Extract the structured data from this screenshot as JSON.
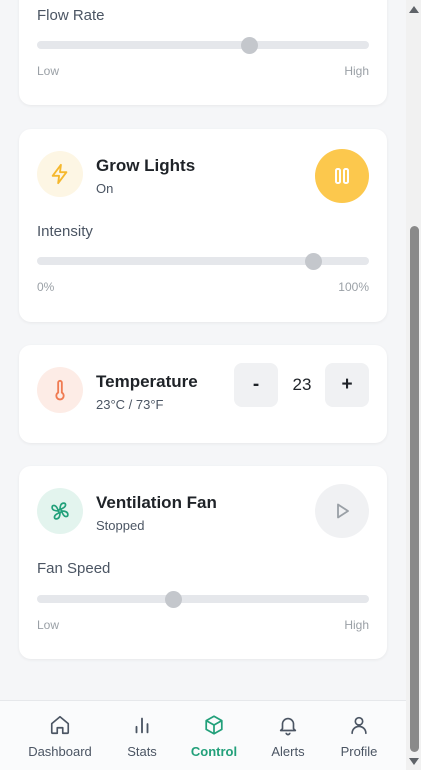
{
  "cards": {
    "flow": {
      "slider_label": "Flow Rate",
      "min_label": "Low",
      "max_label": "High",
      "value_percent": 64
    },
    "lights": {
      "title": "Grow Lights",
      "status": "On",
      "slider_label": "Intensity",
      "min_label": "0%",
      "max_label": "100%",
      "value_percent": 83,
      "icon": "lightning-icon",
      "button_icon": "pause-icon"
    },
    "temperature": {
      "title": "Temperature",
      "status": "23°C / 73°F",
      "minus_label": "-",
      "plus_label": "+",
      "value": "23",
      "icon": "thermometer-icon"
    },
    "fan": {
      "title": "Ventilation Fan",
      "status": "Stopped",
      "slider_label": "Fan Speed",
      "min_label": "Low",
      "max_label": "High",
      "value_percent": 41,
      "icon": "fan-icon",
      "button_icon": "play-icon"
    }
  },
  "nav": {
    "items": [
      {
        "label": "Dashboard",
        "icon": "home-icon"
      },
      {
        "label": "Stats",
        "icon": "bar-chart-icon"
      },
      {
        "label": "Control",
        "icon": "cube-icon",
        "active": true
      },
      {
        "label": "Alerts",
        "icon": "bell-icon"
      },
      {
        "label": "Profile",
        "icon": "user-icon"
      }
    ]
  },
  "colors": {
    "accent": "#22a07a",
    "lights_button": "#fcc84d",
    "lights_icon_bg": "#fdf6e4",
    "temp_icon_bg": "#fdece6",
    "fan_icon_bg": "#e3f4ee"
  }
}
